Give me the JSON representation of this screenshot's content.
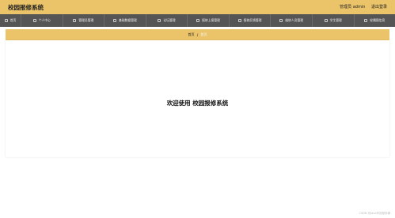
{
  "app": {
    "title": "校园报修系统"
  },
  "header": {
    "user_label": "管理员 admin",
    "logout_label": "退出登录"
  },
  "nav": {
    "items": [
      {
        "label": "首页",
        "icon": "home-icon"
      },
      {
        "label": "个人中心",
        "icon": "user-icon"
      },
      {
        "label": "管理员管理",
        "icon": "admin-icon"
      },
      {
        "label": "基础数据管理",
        "icon": "data-icon"
      },
      {
        "label": "论坛管理",
        "icon": "forum-icon"
      },
      {
        "label": "报修上报管理",
        "icon": "report-icon"
      },
      {
        "label": "报修反馈管理",
        "icon": "feedback-icon"
      },
      {
        "label": "维修人员管理",
        "icon": "worker-icon"
      },
      {
        "label": "学生管理",
        "icon": "student-icon"
      },
      {
        "label": "轮播图信息",
        "icon": "carousel-icon"
      }
    ]
  },
  "breadcrumb": {
    "home": "首页",
    "separator": "/",
    "current": "首页"
  },
  "main": {
    "welcome": "欢迎使用 校园报修系统"
  },
  "footer": {
    "watermark": "CSDN @Java毕设程序源"
  },
  "colors": {
    "accent": "#ebc46a",
    "navbar": "#555555"
  }
}
